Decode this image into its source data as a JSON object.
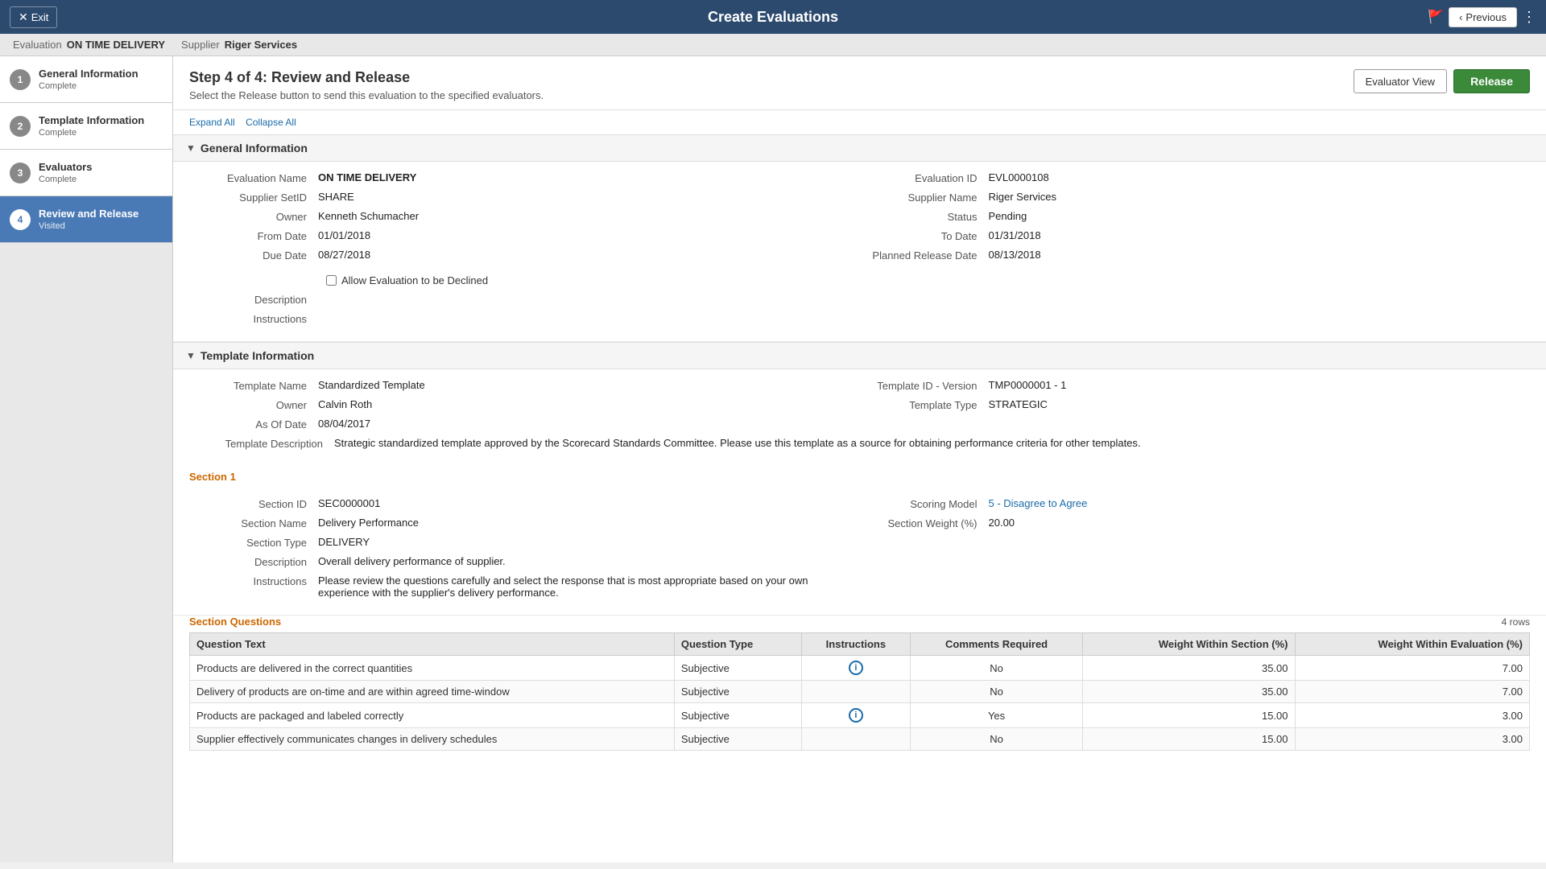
{
  "topBar": {
    "exitLabel": "Exit",
    "title": "Create Evaluations",
    "previousLabel": "Previous",
    "releaseLabel": "Release"
  },
  "subHeader": {
    "evaluationLabel": "Evaluation",
    "evaluationValue": "ON TIME DELIVERY",
    "supplierLabel": "Supplier",
    "supplierValue": "Riger Services"
  },
  "sidebar": {
    "items": [
      {
        "num": "1",
        "title": "General Information",
        "subtitle": "Complete"
      },
      {
        "num": "2",
        "title": "Template Information",
        "subtitle": "Complete"
      },
      {
        "num": "3",
        "title": "Evaluators",
        "subtitle": "Complete"
      },
      {
        "num": "4",
        "title": "Review and Release",
        "subtitle": "Visited"
      }
    ]
  },
  "content": {
    "stepTitle": "Step 4 of 4: Review and Release",
    "stepDescription": "Select the Release button to send this evaluation to the specified evaluators.",
    "expandAllLabel": "Expand All",
    "collapseAllLabel": "Collapse All",
    "evaluatorViewLabel": "Evaluator View",
    "releaseLabel": "Release"
  },
  "generalInfo": {
    "sectionTitle": "General Information",
    "fields": {
      "evaluationNameLabel": "Evaluation Name",
      "evaluationNameValue": "ON TIME DELIVERY",
      "evaluationIdLabel": "Evaluation ID",
      "evaluationIdValue": "EVL0000108",
      "supplierSetIdLabel": "Supplier SetID",
      "supplierSetIdValue": "SHARE",
      "supplierNameLabel": "Supplier Name",
      "supplierNameValue": "Riger Services",
      "ownerLabel": "Owner",
      "ownerValue": "Kenneth Schumacher",
      "statusLabel": "Status",
      "statusValue": "Pending",
      "fromDateLabel": "From Date",
      "fromDateValue": "01/01/2018",
      "toDateLabel": "To Date",
      "toDateValue": "01/31/2018",
      "dueDateLabel": "Due Date",
      "dueDateValue": "08/27/2018",
      "plannedReleaseDateLabel": "Planned Release Date",
      "plannedReleaseDateValue": "08/13/2018",
      "allowDeclineLabel": "Allow Evaluation to be Declined",
      "descriptionLabel": "Description",
      "instructionsLabel": "Instructions"
    }
  },
  "templateInfo": {
    "sectionTitle": "Template Information",
    "fields": {
      "templateNameLabel": "Template Name",
      "templateNameValue": "Standardized Template",
      "templateIdLabel": "Template ID - Version",
      "templateIdValue": "TMP0000001 - 1",
      "ownerLabel": "Owner",
      "ownerValue": "Calvin Roth",
      "templateTypeLabel": "Template Type",
      "templateTypeValue": "STRATEGIC",
      "asOfDateLabel": "As Of Date",
      "asOfDateValue": "08/04/2017",
      "templateDescLabel": "Template Description",
      "templateDescValue": "Strategic standardized template approved by the Scorecard Standards Committee. Please use this template as a source for obtaining performance criteria for other templates."
    }
  },
  "section1": {
    "title": "Section 1",
    "fields": {
      "sectionIdLabel": "Section ID",
      "sectionIdValue": "SEC0000001",
      "scoringModelLabel": "Scoring Model",
      "scoringModelValue": "5 - Disagree to Agree",
      "sectionNameLabel": "Section Name",
      "sectionNameValue": "Delivery Performance",
      "sectionWeightLabel": "Section Weight (%)",
      "sectionWeightValue": "20.00",
      "sectionTypeLabel": "Section Type",
      "sectionTypeValue": "DELIVERY",
      "descriptionLabel": "Description",
      "descriptionValue": "Overall delivery performance of supplier.",
      "instructionsLabel": "Instructions",
      "instructionsValue": "Please review the questions carefully and select the response that is most appropriate based on your own experience with the supplier's delivery performance."
    }
  },
  "sectionQuestions": {
    "title": "Section Questions",
    "rowCount": "4 rows",
    "columns": [
      "Question Text",
      "Question Type",
      "Instructions",
      "Comments Required",
      "Weight Within Section (%)",
      "Weight Within Evaluation (%)"
    ],
    "rows": [
      {
        "questionText": "Products are delivered in the correct quantities",
        "questionType": "Subjective",
        "hasInstructions": true,
        "commentsRequired": "No",
        "weightSection": "35.00",
        "weightEvaluation": "7.00"
      },
      {
        "questionText": "Delivery of products are on-time and are within agreed time-window",
        "questionType": "Subjective",
        "hasInstructions": false,
        "commentsRequired": "No",
        "weightSection": "35.00",
        "weightEvaluation": "7.00"
      },
      {
        "questionText": "Products are packaged and labeled correctly",
        "questionType": "Subjective",
        "hasInstructions": true,
        "commentsRequired": "Yes",
        "weightSection": "15.00",
        "weightEvaluation": "3.00"
      },
      {
        "questionText": "Supplier effectively  communicates changes in delivery schedules",
        "questionType": "Subjective",
        "hasInstructions": false,
        "commentsRequired": "No",
        "weightSection": "15.00",
        "weightEvaluation": "3.00"
      }
    ]
  }
}
